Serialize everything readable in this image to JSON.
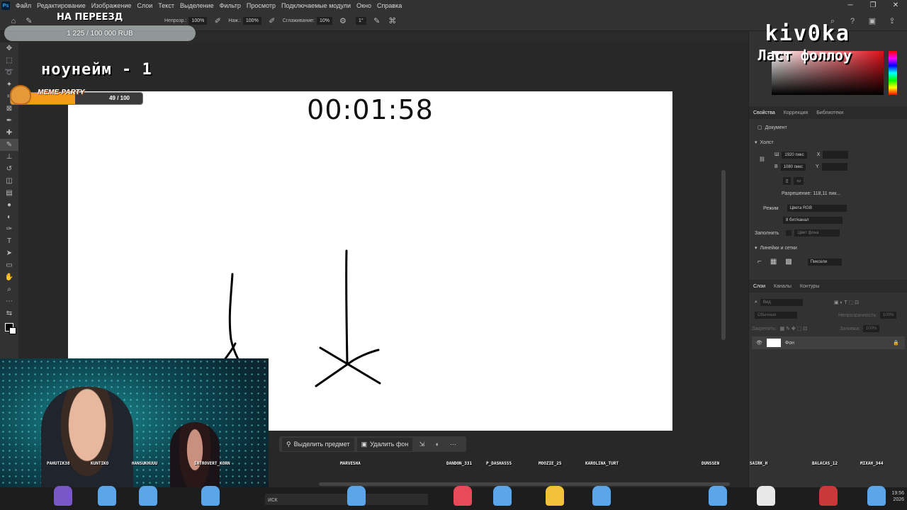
{
  "menu": {
    "items": [
      "Файл",
      "Редактирование",
      "Изображение",
      "Слои",
      "Текст",
      "Выделение",
      "Фильтр",
      "Просмотр",
      "Подключаемые модули",
      "Окно",
      "Справка"
    ]
  },
  "options": {
    "opacity_label": "Непрозр.:",
    "opacity_value": "100%",
    "pressure_label": "Наж.:",
    "pressure_value": "100%",
    "smoothing_label": "Сглаживание:",
    "smoothing_value": "10%",
    "angle_value": "1°"
  },
  "canvas": {
    "timer": "00:01:58",
    "background": "#ffffff"
  },
  "context_bar": {
    "select_subject": "Выделить предмет",
    "remove_bg": "Удалить фон"
  },
  "properties": {
    "tabs": [
      "Свойства",
      "Коррекция",
      "Библиотеки"
    ],
    "document_label": "Документ",
    "canvas_section": "Холст",
    "width_label": "Ш",
    "width_value": "1920 пикс",
    "height_label": "В",
    "height_value": "1080 пикс",
    "x_label": "X",
    "y_label": "Y",
    "resolution": "Разрешение: 118,11 пик...",
    "mode_label": "Режим",
    "mode_value": "Цвета RGB",
    "depth_value": "8 бит/канал",
    "fill_label": "Заполнить",
    "fill_value": "Цвет фона",
    "grid_section": "Линейки и сетки",
    "units_value": "Пиксели"
  },
  "layers": {
    "tabs": [
      "Слои",
      "Каналы",
      "Контуры"
    ],
    "search_placeholder": "Вид",
    "blend_mode": "Обычные",
    "opacity_label": "Непрозрачность:",
    "opacity_value": "100%",
    "lock_label": "Закрепить:",
    "fill_label": "Заливка:",
    "fill_value": "100%",
    "layer_name": "Фон"
  },
  "overlay": {
    "moving_title": "НА ПЕРЕЕЗД",
    "donation_amount": "1 225 / 100 000 RUB",
    "donation_progress": 0.01225,
    "noname": "ноунейм - 1",
    "meme_label": "MEME-PARTY",
    "meme_count": "49 / 100",
    "meme_progress": 0.49,
    "streamer": "kiv0ka",
    "last_follow": "Ласт фоллоу"
  },
  "chatters": [
    "PAHUTIK38",
    "KUNTIKO",
    "HANSUKHUUU",
    "INTROVERT_KORN",
    "MARVESHA",
    "DANDON_331",
    "P_DASHA555",
    "MOOZIE_25",
    "KAROLINA_TURT",
    "DUNSSEN",
    "SAIRK_H",
    "BALACAS_12",
    "MIXAH_344"
  ],
  "taskbar": {
    "search_placeholder": "иск",
    "time": "19:56",
    "date": "2026"
  }
}
